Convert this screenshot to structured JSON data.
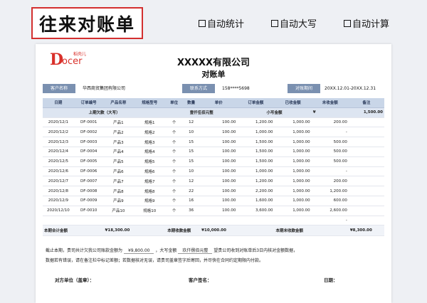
{
  "heading": "往来对账单",
  "features": [
    "自动统计",
    "自动大写",
    "自动计算"
  ],
  "logo": {
    "brand": "Docer",
    "cn": "稻壳儿"
  },
  "doc": {
    "company": "XXXXX有限公司",
    "subtitle": "对账单",
    "info": {
      "customer_label": "客户名称",
      "customer_value": "华西商贸集团有限公司",
      "contact_label": "联系方式",
      "contact_value": "158****5698",
      "period_label": "对账期间",
      "period_value": "20XX.12.01-20XX.12.31"
    },
    "columns": [
      "日期",
      "订单编号",
      "产品名称",
      "规格型号",
      "单位",
      "数量",
      "单价",
      "订单金额",
      "已收金额",
      "未收金额",
      "备注"
    ],
    "prev_row": {
      "label": "上期欠款（大写）",
      "upper": "壹仟伍佰元整",
      "small_label": "小写金额",
      "currency": "¥",
      "value": "1,500.00"
    },
    "rows": [
      [
        "2020/12/1",
        "DF-0001",
        "产品1",
        "规格1",
        "个",
        "12",
        "100.00",
        "1,200.00",
        "1,000.00",
        "200.00",
        ""
      ],
      [
        "2020/12/2",
        "DF-0002",
        "产品2",
        "规格2",
        "个",
        "10",
        "100.00",
        "1,000.00",
        "1,000.00",
        "-",
        ""
      ],
      [
        "2020/12/3",
        "DF-0003",
        "产品3",
        "规格3",
        "个",
        "15",
        "100.00",
        "1,500.00",
        "1,000.00",
        "500.00",
        ""
      ],
      [
        "2020/12/4",
        "DF-0004",
        "产品4",
        "规格4",
        "个",
        "15",
        "100.00",
        "1,500.00",
        "1,000.00",
        "500.00",
        ""
      ],
      [
        "2020/12/5",
        "DF-0005",
        "产品5",
        "规格5",
        "个",
        "15",
        "100.00",
        "1,500.00",
        "1,000.00",
        "500.00",
        ""
      ],
      [
        "2020/12/6",
        "DF-0006",
        "产品6",
        "规格6",
        "个",
        "10",
        "100.00",
        "1,000.00",
        "1,000.00",
        "-",
        ""
      ],
      [
        "2020/12/7",
        "DF-0007",
        "产品7",
        "规格7",
        "个",
        "12",
        "100.00",
        "1,200.00",
        "1,000.00",
        "200.00",
        ""
      ],
      [
        "2020/12/8",
        "DF-0008",
        "产品8",
        "规格8",
        "个",
        "22",
        "100.00",
        "2,200.00",
        "1,000.00",
        "1,200.00",
        ""
      ],
      [
        "2020/12/9",
        "DF-0009",
        "产品9",
        "规格9",
        "个",
        "16",
        "100.00",
        "1,600.00",
        "1,000.00",
        "600.00",
        ""
      ],
      [
        "2020/12/10",
        "DF-0010",
        "产品10",
        "规格10",
        "个",
        "36",
        "100.00",
        "3,600.00",
        "1,000.00",
        "2,600.00",
        ""
      ],
      [
        "",
        "",
        "",
        "",
        "",
        "",
        "",
        "",
        "",
        "-",
        ""
      ]
    ],
    "totals": {
      "total_label": "本期合计金额",
      "total_value": "¥18,300.00",
      "received_label": "本期收款金额",
      "received_value": "¥10,000.00",
      "unreceived_label": "本期未收款金额",
      "unreceived_value": "¥8,300.00"
    },
    "statement": {
      "part1": "截止本期，贵司共计欠我公司账款金额为",
      "amount": "¥9,800.00",
      "part2": "，大写金额",
      "upper": "玖仟捌佰元整",
      "part3": "望贵公司收到对账单后3日内核对金额数据，",
      "line2": "数据若有错误，请在备注栏中标记差额；若数据核对无误，请贵司盖章签字后寄回，并尽快在合同约定期限内付款。"
    },
    "signatures": [
      "对方单位（盖章）：",
      "客户签名：",
      "日期："
    ]
  }
}
